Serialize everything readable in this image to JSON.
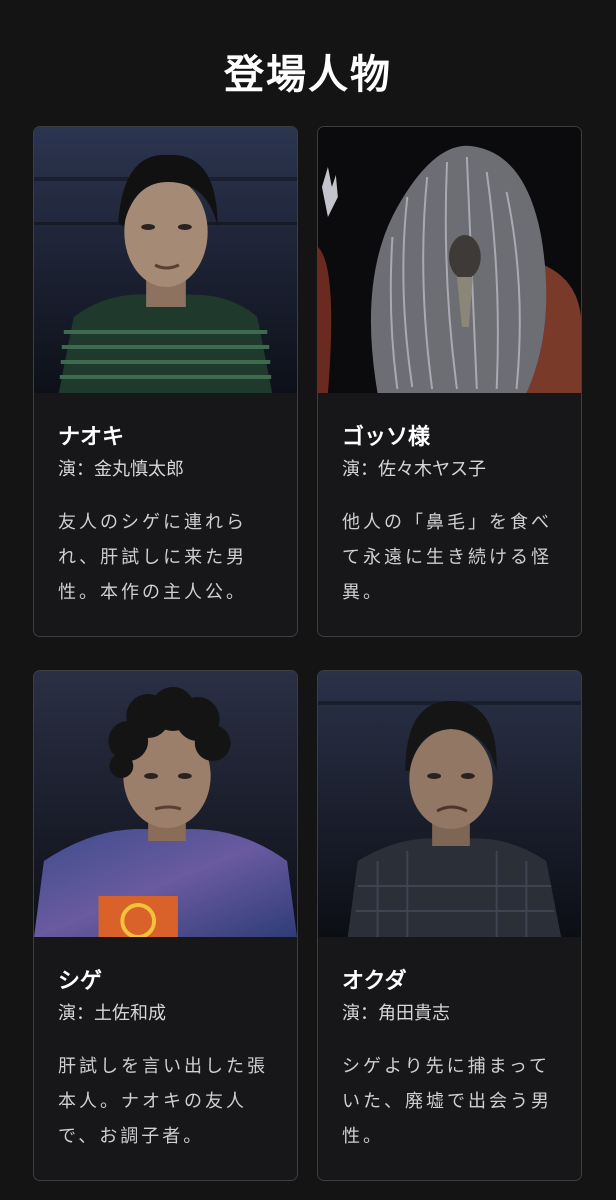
{
  "page": {
    "title": "登場人物"
  },
  "colors": {
    "background": "#141414",
    "card_background": "#17171a",
    "card_border": "#3d3d42",
    "text_primary": "#ffffff",
    "text_secondary": "#cfcfcf"
  },
  "characters": [
    {
      "name": "ナオキ",
      "actor": "演：金丸慎太郎",
      "description": "友人のシゲに連れられ、肝試しに来た男性。本作の主人公。",
      "photo_icon": "man-green-striped-shirt-portrait"
    },
    {
      "name": "ゴッソ様",
      "actor": "演：佐々木ヤス子",
      "description": "他人の「鼻毛」を食べて永遠に生き続ける怪異。",
      "photo_icon": "long-gray-haired-monster-portrait"
    },
    {
      "name": "シゲ",
      "actor": "演：土佐和成",
      "description": "肝試しを言い出した張本人。ナオキの友人で、お調子者。",
      "photo_icon": "man-tie-dye-shirt-portrait"
    },
    {
      "name": "オクダ",
      "actor": "演：角田貴志",
      "description": "シゲより先に捕まっていた、廃墟で出会う男性。",
      "photo_icon": "man-dirty-plaid-shirt-portrait"
    }
  ]
}
